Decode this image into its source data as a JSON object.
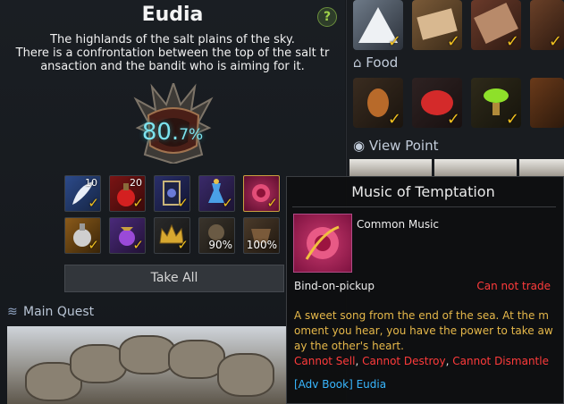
{
  "region": {
    "title": "Eudia",
    "help_glyph": "?",
    "description_lines": [
      "The highlands of the salt plains of the sky.",
      "There is a confrontation between the top of the salt tr",
      "ansaction and the bandit who is aiming for it."
    ],
    "progress_main": "80.",
    "progress_fraction": "7%",
    "progress_value": 80.7
  },
  "rewards": {
    "row1_counts": [
      "10",
      "20"
    ],
    "row2_percents": [
      "90%",
      "100%"
    ],
    "take_all_label": "Take All"
  },
  "main_quest": {
    "label": "Main Quest",
    "icon": "quest-emblem-icon"
  },
  "right_panel": {
    "food_label": "Food",
    "food_icon": "house-icon",
    "view_point_label": "View Point",
    "view_point_icon": "eye-icon",
    "check_glyph": "✓"
  },
  "tooltip": {
    "name": "Music of Temptation",
    "type": "Common Music",
    "bind": "Bind-on-pickup",
    "trade": "Can not trade",
    "flavor_lines": [
      "A sweet song from the end of the sea. At the m",
      "oment you hear, you have the power to take aw",
      "ay the other's heart."
    ],
    "restrictions": [
      "Cannot Sell",
      "Cannot Destroy",
      "Cannot Dismantle"
    ],
    "source": "[Adv Book] Eudia"
  },
  "colors": {
    "accent_cyan": "#7de4ef",
    "check_gold": "#f0c020",
    "restriction_red": "#ff3b3b",
    "flavor_gold": "#e6b84a",
    "source_blue": "#38b7ff"
  }
}
